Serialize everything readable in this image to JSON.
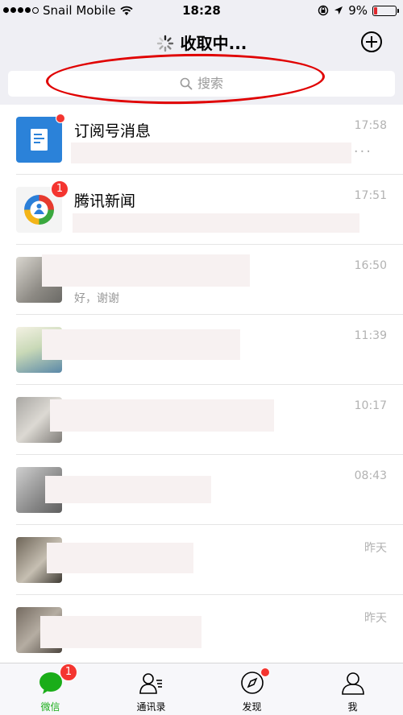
{
  "status_bar": {
    "carrier": "Snail Mobile",
    "time": "18:28",
    "battery": "9%"
  },
  "nav": {
    "title": "收取中..."
  },
  "search": {
    "placeholder": "搜索"
  },
  "chats": [
    {
      "name": "订阅号消息",
      "time": "17:58",
      "badge_dot": true,
      "preview": ""
    },
    {
      "name": "腾讯新闻",
      "time": "17:51",
      "badge": "1",
      "preview": ""
    },
    {
      "name": "",
      "time": "16:50",
      "preview": "好，谢谢"
    },
    {
      "name": "",
      "time": "11:39",
      "preview": ""
    },
    {
      "name": "",
      "time": "10:17",
      "preview": ""
    },
    {
      "name": "",
      "time": "08:43",
      "preview": ""
    },
    {
      "name": "",
      "time": "昨天",
      "preview": ""
    },
    {
      "name": "",
      "time": "昨天",
      "preview": ""
    }
  ],
  "tabs": [
    {
      "label": "微信",
      "badge": "1",
      "active": true
    },
    {
      "label": "通讯录"
    },
    {
      "label": "发现",
      "badge_dot": true
    },
    {
      "label": "我"
    }
  ],
  "colors": {
    "accent": "#1aad19",
    "badge": "#f43530",
    "annotation": "#e00000"
  }
}
